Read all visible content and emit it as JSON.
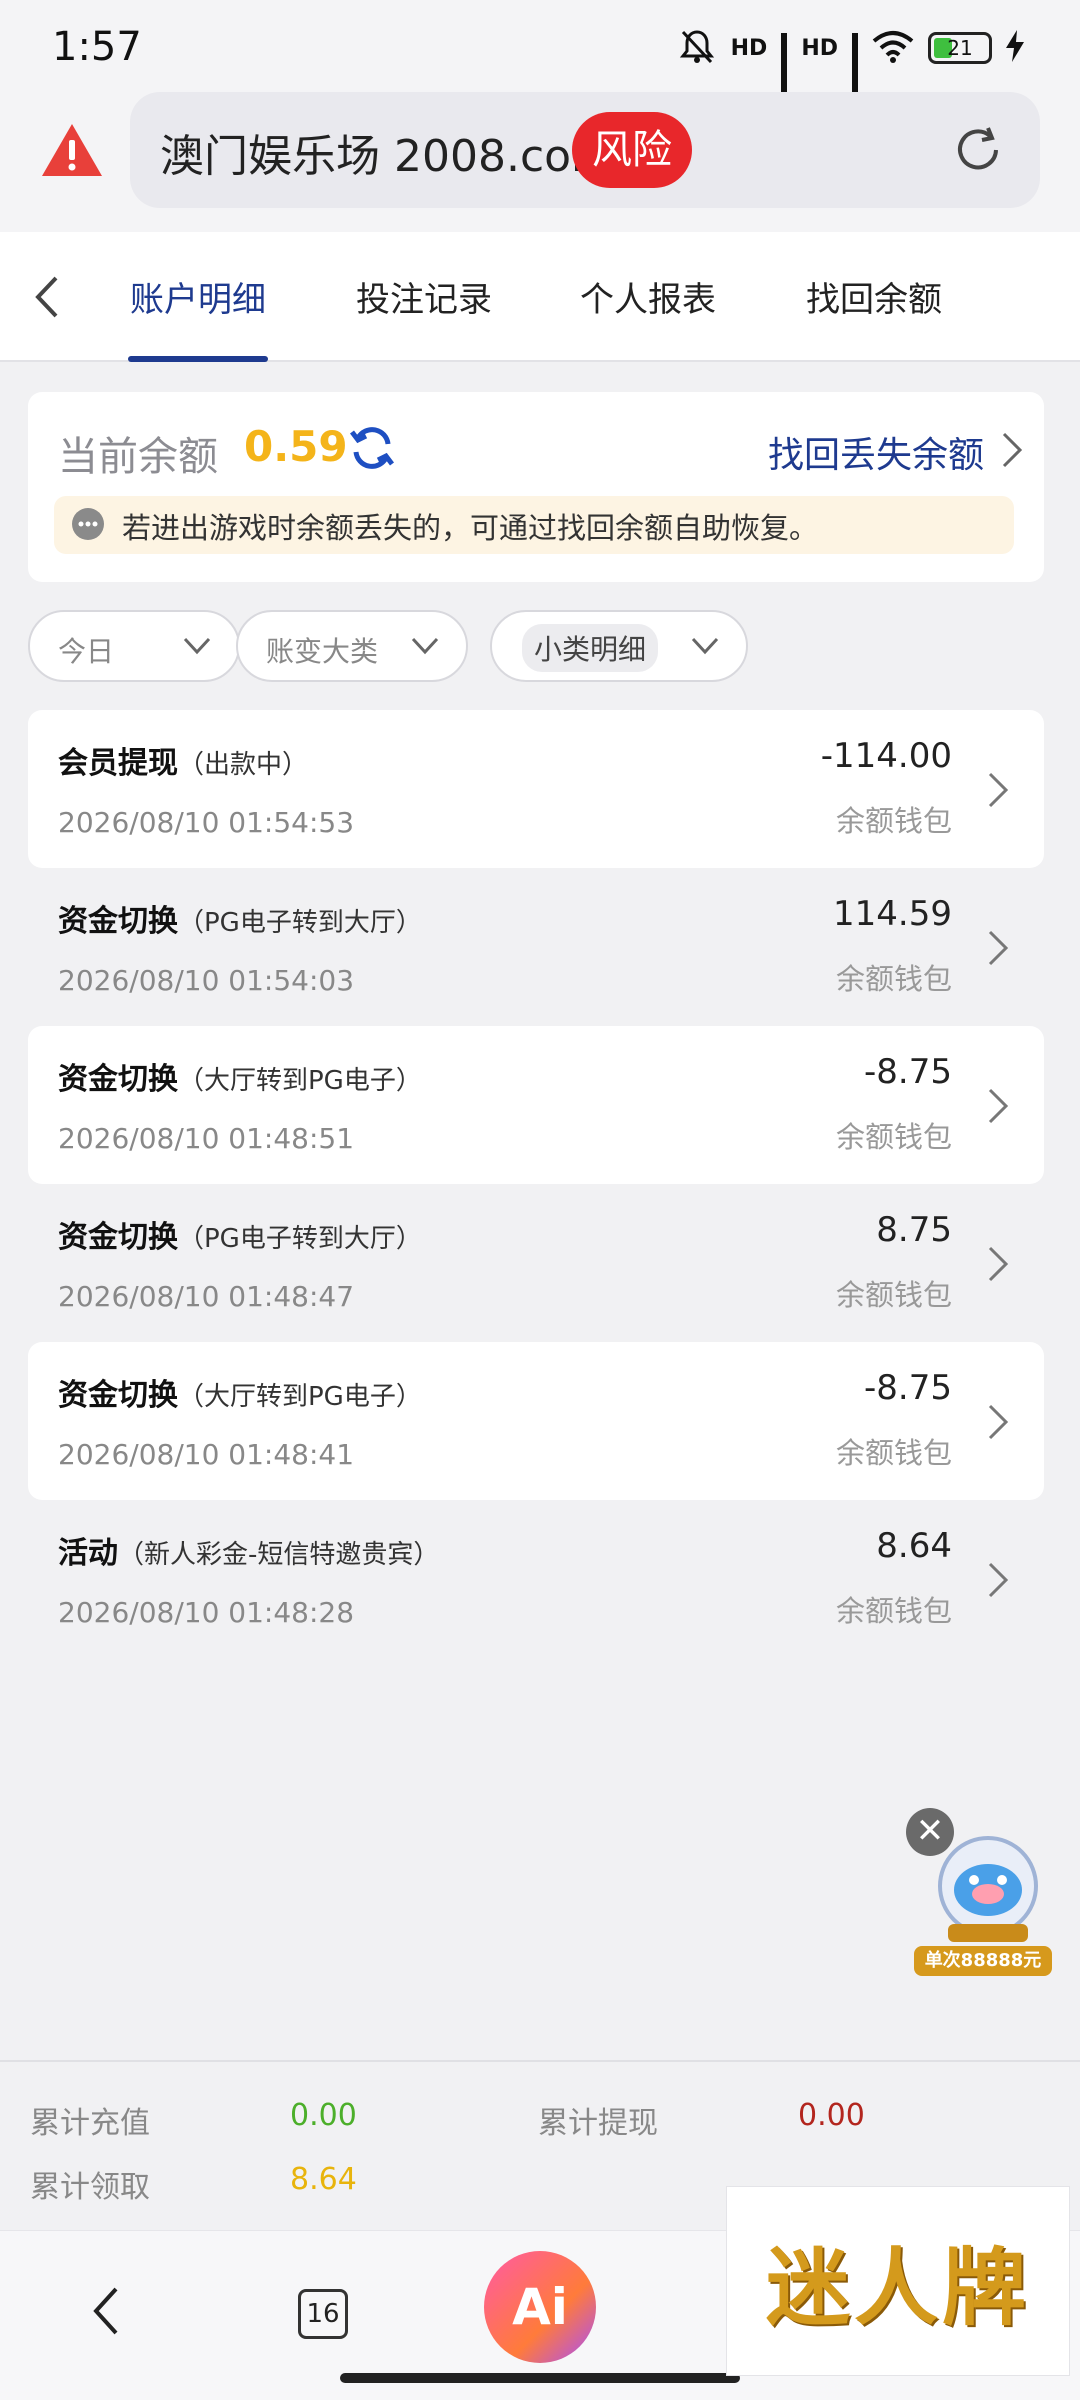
{
  "status_bar": {
    "time": "1:57",
    "signal_labels": [
      "HD",
      "HD"
    ],
    "battery": "21"
  },
  "url_bar": {
    "url": "澳门娱乐场 2008.com",
    "risk_label": "风险"
  },
  "tabs": [
    {
      "label": "账户明细",
      "active": true
    },
    {
      "label": "投注记录",
      "active": false
    },
    {
      "label": "个人报表",
      "active": false
    },
    {
      "label": "找回余额",
      "active": false
    }
  ],
  "balance": {
    "label": "当前余额",
    "value": "0.59",
    "recover_label": "找回丢失余额",
    "notice": "若进出游戏时余额丢失的，可通过找回余额自助恢复。"
  },
  "filters": {
    "date": "今日",
    "category": "账变大类",
    "subcategory": "小类明细"
  },
  "records": [
    {
      "title": "会员提现",
      "sub": "（出款中）",
      "date": "2026/08/10 01:54:53",
      "amount": "-114.00",
      "wallet": "余额钱包"
    },
    {
      "title": "资金切换",
      "sub": "（PG电子转到大厅）",
      "date": "2026/08/10 01:54:03",
      "amount": "114.59",
      "wallet": "余额钱包"
    },
    {
      "title": "资金切换",
      "sub": "（大厅转到PG电子）",
      "date": "2026/08/10 01:48:51",
      "amount": "-8.75",
      "wallet": "余额钱包"
    },
    {
      "title": "资金切换",
      "sub": "（PG电子转到大厅）",
      "date": "2026/08/10 01:48:47",
      "amount": "8.75",
      "wallet": "余额钱包"
    },
    {
      "title": "资金切换",
      "sub": "（大厅转到PG电子）",
      "date": "2026/08/10 01:48:41",
      "amount": "-8.75",
      "wallet": "余额钱包"
    },
    {
      "title": "活动",
      "sub": "（新人彩金-短信特邀贵宾）",
      "date": "2026/08/10 01:48:28",
      "amount": "8.64",
      "wallet": "余额钱包"
    }
  ],
  "mascot": {
    "ribbon": "单次88888元",
    "close": "✕"
  },
  "totals": {
    "deposit_label": "累计充值",
    "deposit_value": "0.00",
    "withdraw_label": "累计提现",
    "withdraw_value": "0.00",
    "claim_label": "累计领取",
    "claim_value": "8.64"
  },
  "bottom_bar": {
    "tab_count": "16",
    "ai_label": "Ai"
  },
  "watermark": "迷人牌",
  "colors": {
    "accent_blue": "#1e3a8f",
    "balance_yellow": "#f4b41a",
    "risk_red": "#e8272b",
    "deposit_green": "#4caf2a",
    "withdraw_red": "#b3261e",
    "claim_yellow": "#e8b40c"
  }
}
